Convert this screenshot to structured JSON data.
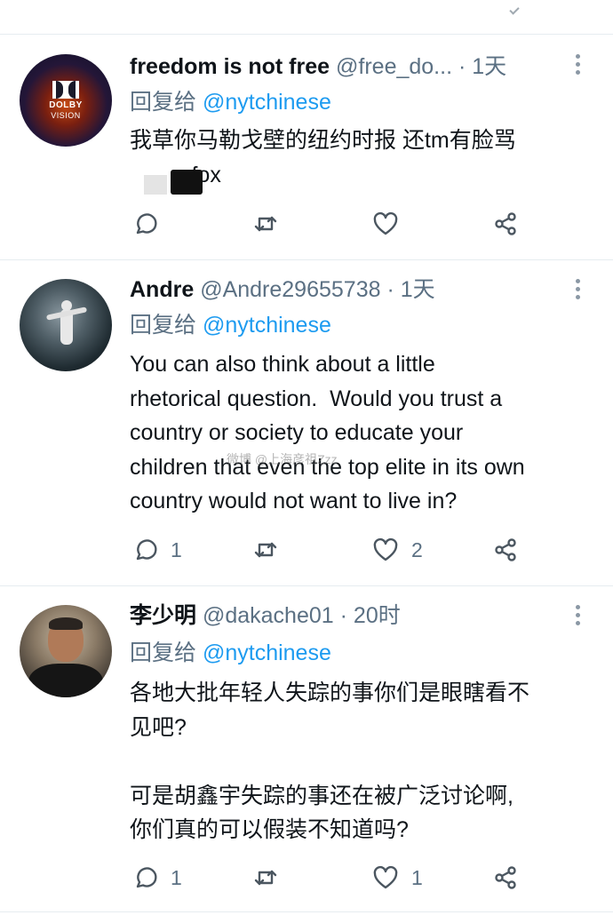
{
  "tweets": [
    {
      "name": "freedom is not free",
      "handle": "@free_do...",
      "time": "· 1天",
      "replying_label": "回复给",
      "replying_to": "@nytchinese",
      "text": "我草你马勒戈壁的纽约时报 还tm有脸骂\n          fox",
      "avatar_text_1": "DOLBY",
      "avatar_text_2": "VISION",
      "reply_count": "",
      "like_count": ""
    },
    {
      "name": "Andre",
      "handle": "@Andre29655738",
      "time": "· 1天",
      "replying_label": "回复给",
      "replying_to": "@nytchinese",
      "text": "You can also think about a little\nrhetorical question.  Would you trust a\ncountry or society to educate your\nchildren that even the top elite in its own\ncountry would not want to live in?",
      "reply_count": "1",
      "like_count": "2"
    },
    {
      "name": "李少明",
      "handle": "@dakache01",
      "time": "· 20时",
      "replying_label": "回复给",
      "replying_to": "@nytchinese",
      "text": "各地大批年轻人失踪的事你们是眼瞎看不\n见吧?\n\n可是胡鑫宇失踪的事还在被广泛讨论啊,\n你们真的可以假装不知道吗?",
      "reply_count": "1",
      "like_count": "1"
    }
  ],
  "watermark": "微博 @上海彦祖Zzz"
}
